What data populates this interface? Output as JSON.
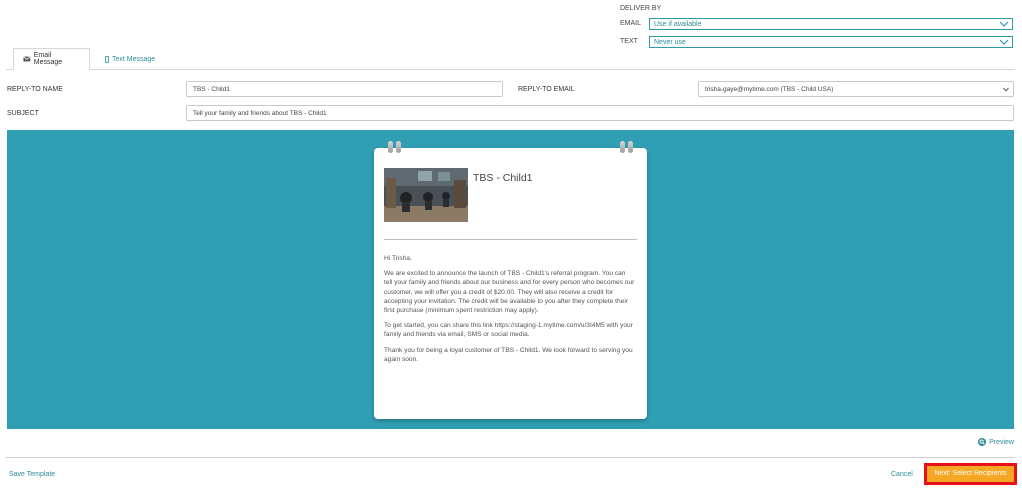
{
  "deliver": {
    "title": "DELIVER BY",
    "email_label": "EMAIL",
    "email_value": "Use if available",
    "text_label": "TEXT",
    "text_value": "Never use"
  },
  "tabs": [
    {
      "label": "Email Message",
      "icon": "envelope-icon"
    },
    {
      "label": "Text Message",
      "icon": "mobile-icon"
    }
  ],
  "form": {
    "reply_to_name_label": "REPLY-TO NAME",
    "reply_to_name_value": "TBS - Child1",
    "reply_to_email_label": "REPLY-TO EMAIL",
    "reply_to_email_value": "trisha-gaye@mytime.com (TBS - Child USA)",
    "subject_label": "SUBJECT",
    "subject_value": "Tell your family and friends about TBS - Child1"
  },
  "preview_card": {
    "title": "TBS - Child1",
    "greeting": "Hi Trisha,",
    "paragraph1": "We are excited to announce the launch of TBS - Child1's referral program. You can tell your family and friends about our business and for every person who becomes our customer, we will offer you a credit of $20.00. They will also receive a credit for accepting your invitation. The credit will be available to you after they complete their first purchase (minimum spent restriction may apply).",
    "paragraph2": "To get started, you can share this link https://staging-1.mytime.com/u/3I4M5 with your family and friends via email, SMS or social media.",
    "paragraph3": "Thank you for being a loyal customer of TBS - Child1. We look forward to serving you again soon."
  },
  "footer": {
    "preview_label": "Preview",
    "save_template_label": "Save Template",
    "cancel_label": "Cancel",
    "next_label": "Next: Select Recipients"
  },
  "colors": {
    "accent": "#2e8d9a",
    "banner": "#309fb3",
    "primary_button": "#f5a623",
    "highlight_border": "#e8101a"
  }
}
